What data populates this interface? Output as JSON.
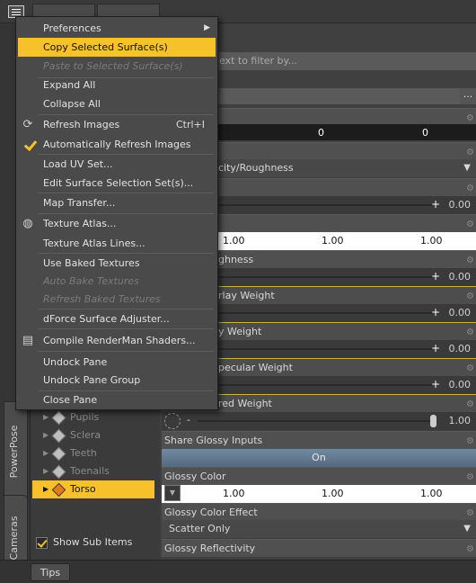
{
  "menu": {
    "items": [
      {
        "label": "Preferences",
        "submenu": true
      },
      {
        "label": "Copy Selected Surface(s)",
        "highlighted": true
      },
      {
        "label": "Paste to Selected Surface(s)",
        "disabled": true
      },
      {
        "label": "Expand All"
      },
      {
        "label": "Collapse All"
      },
      {
        "label": "Refresh Images",
        "shortcut": "Ctrl+I",
        "icon": "refresh-icon"
      },
      {
        "label": "Automatically Refresh Images",
        "icon": "checkmark-icon"
      },
      {
        "label": "Load UV Set..."
      },
      {
        "label": "Edit Surface Selection Set(s)..."
      },
      {
        "label": "Map Transfer..."
      },
      {
        "label": "Texture Atlas...",
        "icon": "globe-icon"
      },
      {
        "label": "Texture Atlas Lines..."
      },
      {
        "label": "Use Baked Textures"
      },
      {
        "label": "Auto Bake Textures",
        "disabled": true
      },
      {
        "label": "Refresh Baked Textures",
        "disabled": true
      },
      {
        "label": "dForce Surface Adjuster..."
      },
      {
        "label": "Compile RenderMan Shaders...",
        "icon": "script-icon"
      },
      {
        "label": "Undock Pane"
      },
      {
        "label": "Undock Pane Group"
      },
      {
        "label": "Close Pane"
      }
    ]
  },
  "sidebar_tabs": [
    "PowerPose",
    "Cameras"
  ],
  "tree": {
    "items": [
      {
        "label": "Pupils"
      },
      {
        "label": "Sclera"
      },
      {
        "label": "Teeth"
      },
      {
        "label": "Toenails"
      },
      {
        "label": "Torso",
        "selected": true
      }
    ],
    "show_sub_items_label": "Show Sub Items"
  },
  "bottom_tab": "Tips",
  "filter_placeholder": "ext to filter by...",
  "properties": {
    "zero_values": [
      "0",
      "0"
    ],
    "lighting_model_partial": "city/Roughness",
    "value_000": "0.00",
    "color_values": [
      "1.00",
      "1.00",
      "1.00"
    ],
    "roughness_partial": "ghness",
    "overlay_weight_partial": "rlay Weight",
    "weight_partial": "y Weight",
    "specular_weight_partial": "pecular Weight",
    "layered_weight_partial": "red Weight",
    "value_100": "1.00",
    "share_glossy_label": "Share Glossy Inputs",
    "share_glossy_value": "On",
    "glossy_color_label": "Glossy Color",
    "glossy_color_effect_label": "Glossy Color Effect",
    "glossy_color_effect_value": "Scatter Only",
    "glossy_reflectivity_label": "Glossy Reflectivity"
  }
}
